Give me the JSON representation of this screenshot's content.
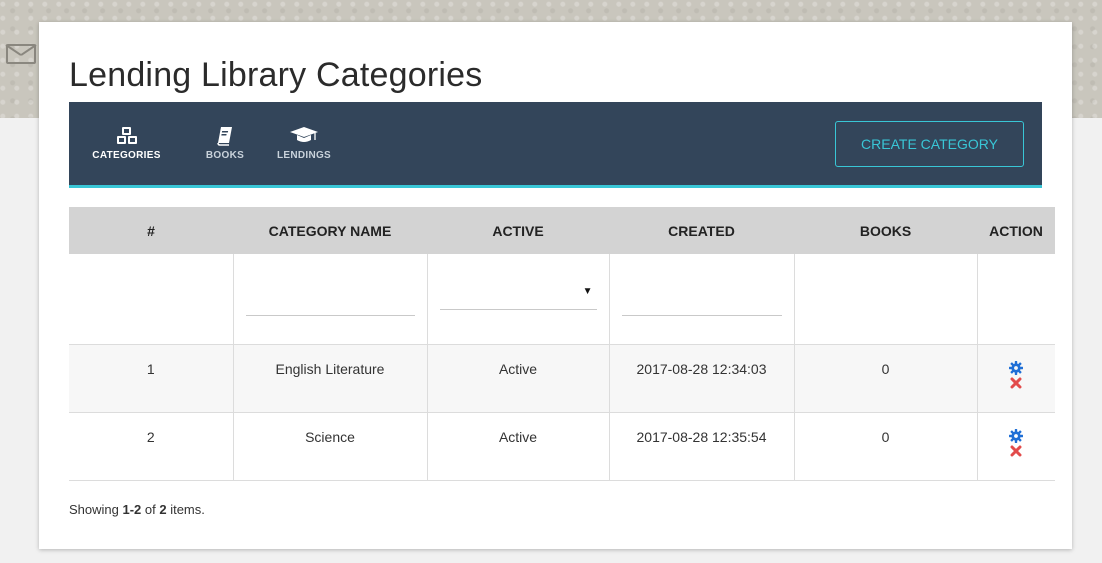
{
  "page": {
    "title": "Lending Library Categories"
  },
  "nav": {
    "tabs": [
      {
        "label": "CATEGORIES",
        "icon": "cubes-icon",
        "active": true
      },
      {
        "label": "BOOKS",
        "icon": "book-icon",
        "active": false
      },
      {
        "label": "LENDINGS",
        "icon": "graduation-cap-icon",
        "active": false
      }
    ],
    "create_label": "CREATE CATEGORY"
  },
  "table": {
    "headers": [
      "#",
      "CATEGORY NAME",
      "ACTIVE",
      "CREATED",
      "BOOKS",
      "ACTION"
    ],
    "filters": {
      "name": "",
      "active": "",
      "created": ""
    },
    "rows": [
      {
        "num": "1",
        "name": "English Literature",
        "active": "Active",
        "created": "2017-08-28 12:34:03",
        "books": "0"
      },
      {
        "num": "2",
        "name": "Science",
        "active": "Active",
        "created": "2017-08-28 12:35:54",
        "books": "0"
      }
    ]
  },
  "summary": {
    "prefix": "Showing ",
    "range": "1-2",
    "middle": " of ",
    "total": "2",
    "suffix": " items."
  },
  "colors": {
    "navbar": "#33455a",
    "accent": "#39c6d6",
    "edit": "#1f6fd6",
    "delete": "#e24b4b",
    "header": "#d3d3d3"
  }
}
